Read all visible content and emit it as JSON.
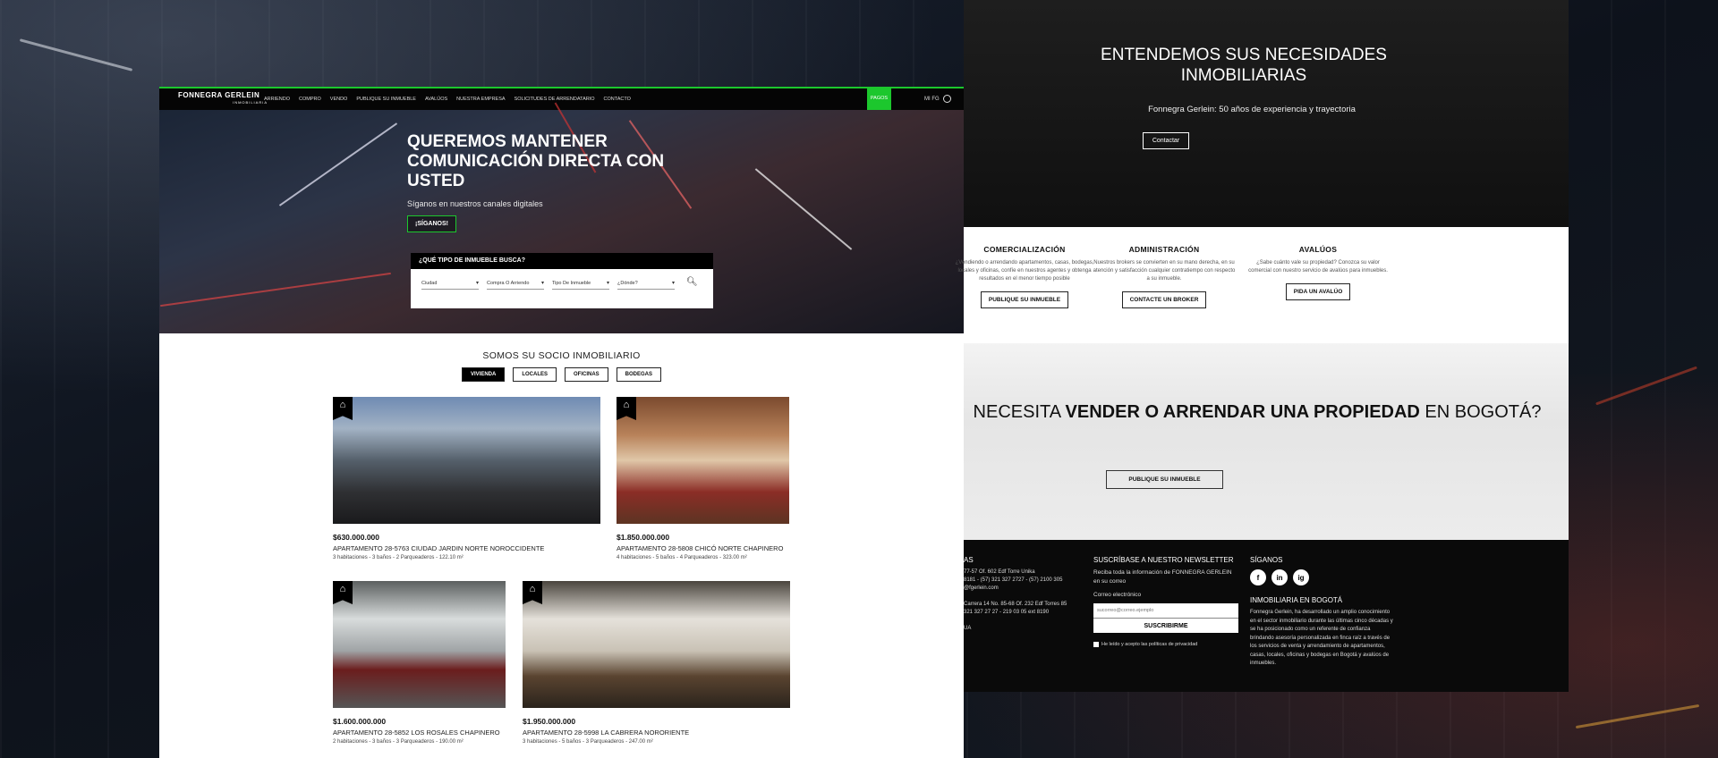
{
  "left": {
    "nav": {
      "logo": "FONNEGRA GERLEIN",
      "logo_sub": "INMOBILIARIA",
      "items": [
        "ARRIENDO",
        "COMPRO",
        "VENDO",
        "PUBLIQUE SU INMUEBLE",
        "AVALÚOS",
        "NUESTRA EMPRESA",
        "SOLICITUDES DE ARRENDATARIO",
        "CONTACTO"
      ],
      "pagos": "PAGOS",
      "account": "MI FG"
    },
    "hero": {
      "title": "QUEREMOS MANTENER COMUNICACIÓN DIRECTA CON USTED",
      "subtitle": "Síganos en nuestros canales digitales",
      "button": "¡SÍGANOS!"
    },
    "search": {
      "heading": "¿QUÉ TIPO DE INMUEBLE BUSCA?",
      "fields": [
        "Ciudad",
        "Compra O Arriendo",
        "Tipo De Inmueble",
        "¿Dónde?"
      ]
    },
    "socio": {
      "title": "SOMOS SU SOCIO INMOBILIARIO",
      "tabs": [
        "VIVIENDA",
        "LOCALES",
        "OFICINAS",
        "BODEGAS"
      ]
    },
    "listings": [
      {
        "price": "$630.000.000",
        "title": "APARTAMENTO 28-5763 CIUDAD JARDIN NORTE NOROCCIDENTE",
        "desc": "3 habitaciones - 3 baños - 2 Parqueaderos - 122.10 m²"
      },
      {
        "price": "$1.850.000.000",
        "title": "APARTAMENTO 28-5808 CHICÓ NORTE CHAPINERO",
        "desc": "4 habitaciones - 5 baños - 4 Parqueaderos - 323.00 m²"
      },
      {
        "price": "$1.600.000.000",
        "title": "APARTAMENTO 28-5852 LOS ROSALES CHAPINERO",
        "desc": "2 habitaciones - 3 baños - 3 Parqueaderos - 190.00 m²"
      },
      {
        "price": "$1.950.000.000",
        "title": "APARTAMENTO 28-5998 LA CABRERA NORORIENTE",
        "desc": "3 habitaciones - 5 baños - 3 Parqueaderos - 247.00 m²"
      }
    ]
  },
  "right": {
    "top": {
      "title": "ENTENDEMOS SUS NECESIDADES INMOBILIARIAS",
      "subtitle": "Fonnegra Gerlein: 50 años de experiencia y trayectoria",
      "button": "Contactar"
    },
    "services": [
      {
        "title": "COMERCIALIZACIÓN",
        "desc": "¿Vendiendo o arrendando apartamentos, casas, bodegas, locales y oficinas, confíe en nuestros agentes y obtenga resultados en el menor tiempo posible",
        "button": "PUBLIQUE SU INMUEBLE"
      },
      {
        "title": "ADMINISTRACIÓN",
        "desc": "Nuestros brokers se convierten en su mano derecha, en su atención y satisfacción cualquier contratiempo con respecto a su inmueble.",
        "button": "CONTACTE UN BROKER"
      },
      {
        "title": "AVALÚOS",
        "desc": "¿Sabe cuánto vale su propiedad? Conozca su valor comercial con nuestro servicio de avalúos para inmuebles.",
        "button": "PIDA UN AVALÚO"
      }
    ],
    "sell": {
      "pre": "NECESITA ",
      "bold1": "VENDER O ARRENDAR UNA PROPIEDAD",
      "post": " EN BOGOTÁ?",
      "button": "PUBLIQUE SU INMUEBLE"
    },
    "footer": {
      "contact_heading": "AS",
      "contact_lines": [
        "77-57 Of. 602 Edf Torre Unika",
        "8181 - (57) 321 327 2727 - (57) 2100 305",
        "@fgerlein.com",
        "",
        "Carrera 14 No. 85-68 Of. 232 Edf Torres 85",
        "321 327 27 27 - 219 03 05 ext 8190",
        "",
        "UA"
      ],
      "newsletter_heading": "SUSCRÍBASE A NUESTRO NEWSLETTER",
      "newsletter_text": "Reciba toda la información de FONNEGRA GERLEIN en su correo",
      "email_label": "Correo electrónico",
      "email_placeholder": "sucorreo@correo.ejemplo",
      "subscribe": "SUSCRIBIRME",
      "privacy": "He leído y acepto las políticas de privacidad",
      "follow_heading": "SÍGANOS",
      "socials": [
        "f",
        "in",
        "ig"
      ],
      "about_heading": "INMOBILIARIA EN BOGOTÁ",
      "about_text": "Fonnegra Gerlein, ha desarrollado un amplio conocimiento en el sector inmobiliario durante las últimas cinco décadas y se ha posicionado como un referente de confianza brindando asesoría personalizada en finca raíz a través de los servicios de venta y arrendamiento de apartamentos, casas, locales, oficinas y bodegas en Bogotá y avalúos de inmuebles."
    }
  },
  "colors": {
    "accent": "#1cc72d",
    "dark": "#050505"
  }
}
